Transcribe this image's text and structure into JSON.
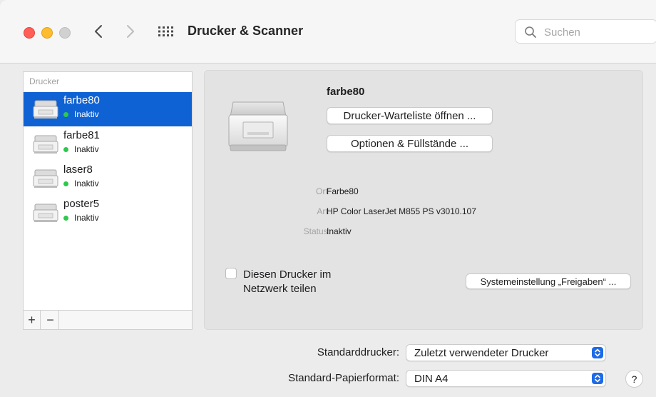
{
  "window": {
    "title": "Drucker & Scanner",
    "search": {
      "placeholder": "Suchen",
      "value": ""
    }
  },
  "printer_list": {
    "header": "Drucker",
    "items": [
      {
        "name": "farbe80",
        "status": "Inaktiv",
        "selected": true
      },
      {
        "name": "farbe81",
        "status": "Inaktiv",
        "selected": false
      },
      {
        "name": "laser8",
        "status": "Inaktiv",
        "selected": false
      },
      {
        "name": "poster5",
        "status": "Inaktiv",
        "selected": false
      }
    ],
    "add_label": "+",
    "remove_label": "−"
  },
  "detail": {
    "name": "farbe80",
    "open_queue_label": "Drucker-Warteliste öffnen ...",
    "options_label": "Optionen & Füllstände ...",
    "info": {
      "ort_label": "Ort:",
      "ort_value": "Farbe80",
      "art_label": "Art:",
      "art_value": "HP Color LaserJet M855 PS v3010.107",
      "status_label": "Status:",
      "status_value": "Inaktiv"
    },
    "share_label": "Diesen Drucker im Netzwerk teilen",
    "share_checked": false,
    "sharing_prefs_label": "Systemeinstellung „Freigaben“ ..."
  },
  "settings": {
    "default_printer_label": "Standarddrucker:",
    "default_printer_value": "Zuletzt verwendeter Drucker",
    "paper_size_label": "Standard-Papierformat:",
    "paper_size_value": "DIN A4",
    "help_label": "?"
  },
  "colors": {
    "accent": "#0f62d4",
    "status_active": "#2ec84d",
    "select_button": "#1e6be6"
  }
}
